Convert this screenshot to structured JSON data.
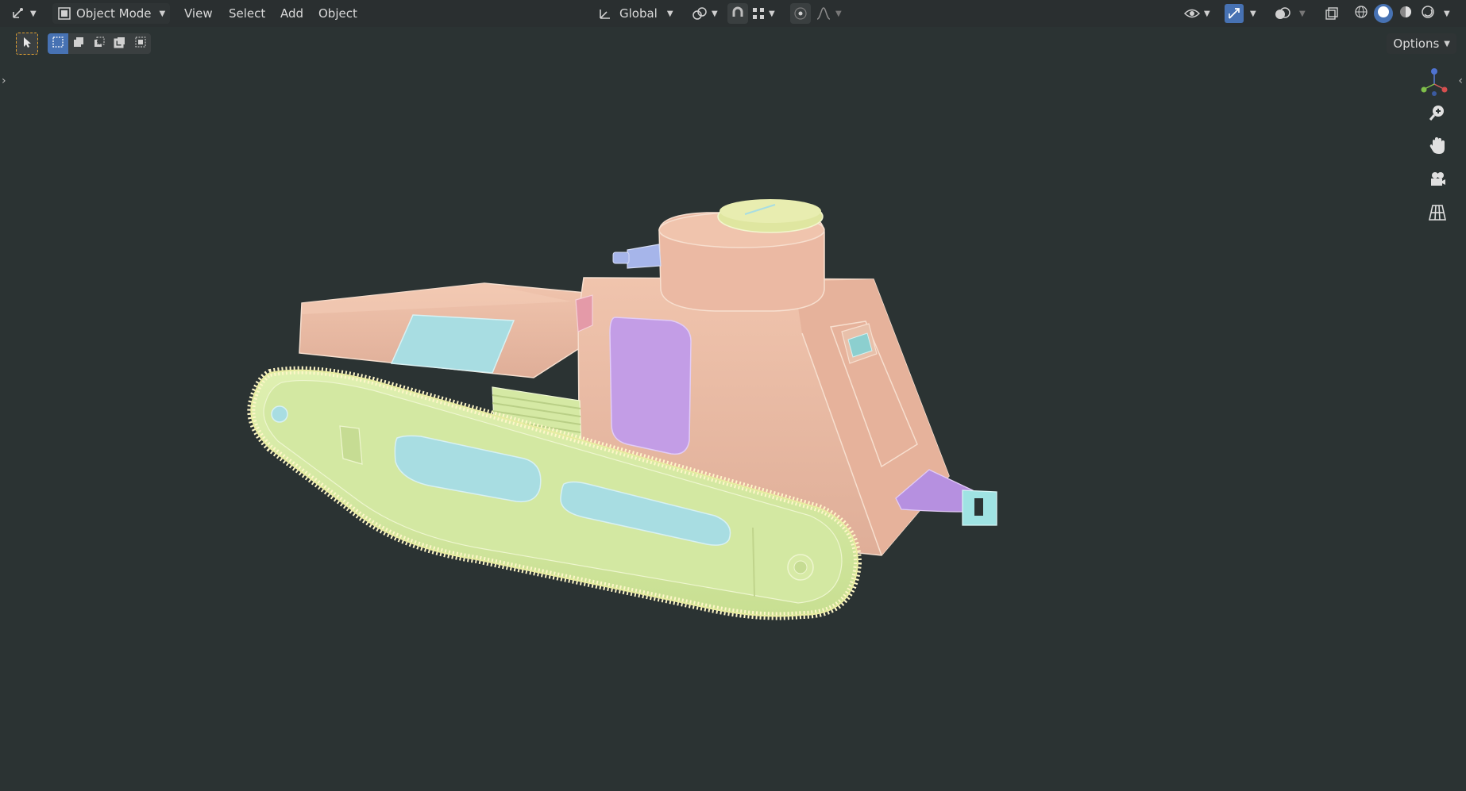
{
  "header": {
    "mode": "Object Mode",
    "menus": [
      "View",
      "Select",
      "Add",
      "Object"
    ],
    "transform_orientation": "Global",
    "options_label": "Options"
  },
  "icons": {
    "editor_type": "view3d-editor-icon",
    "mode": "object-mode-icon",
    "orientation": "transform-orientation-icon",
    "pivot": "pivot-point-icon",
    "snap": "snap-magnet-icon",
    "snap_target": "snap-grid-icon",
    "proportional": "proportional-edit-icon",
    "falloff": "falloff-curve-icon",
    "visibility": "eye-icon",
    "gizmo": "gizmo-icon",
    "overlay": "overlay-icon",
    "xray": "xray-icon",
    "shading_wire": "wireframe-shading-icon",
    "shading_solid": "solid-shading-icon",
    "shading_material": "material-shading-icon",
    "shading_rendered": "rendered-shading-icon",
    "select_tool": "select-box-tool-icon",
    "zoom": "zoom-icon",
    "pan": "hand-pan-icon",
    "camera": "camera-icon",
    "ortho": "grid-ortho-icon",
    "axis_gizmo": "axis-navigation-gizmo"
  },
  "colors": {
    "viewport_bg": "#2b3333",
    "accent": "#4772b3",
    "hull": "#e9b8a3",
    "track": "#d5e9a4",
    "glass": "#a8dde2",
    "door": "#c39de6",
    "dome": "#dfe6a0",
    "gun": "#a6b5ea"
  }
}
